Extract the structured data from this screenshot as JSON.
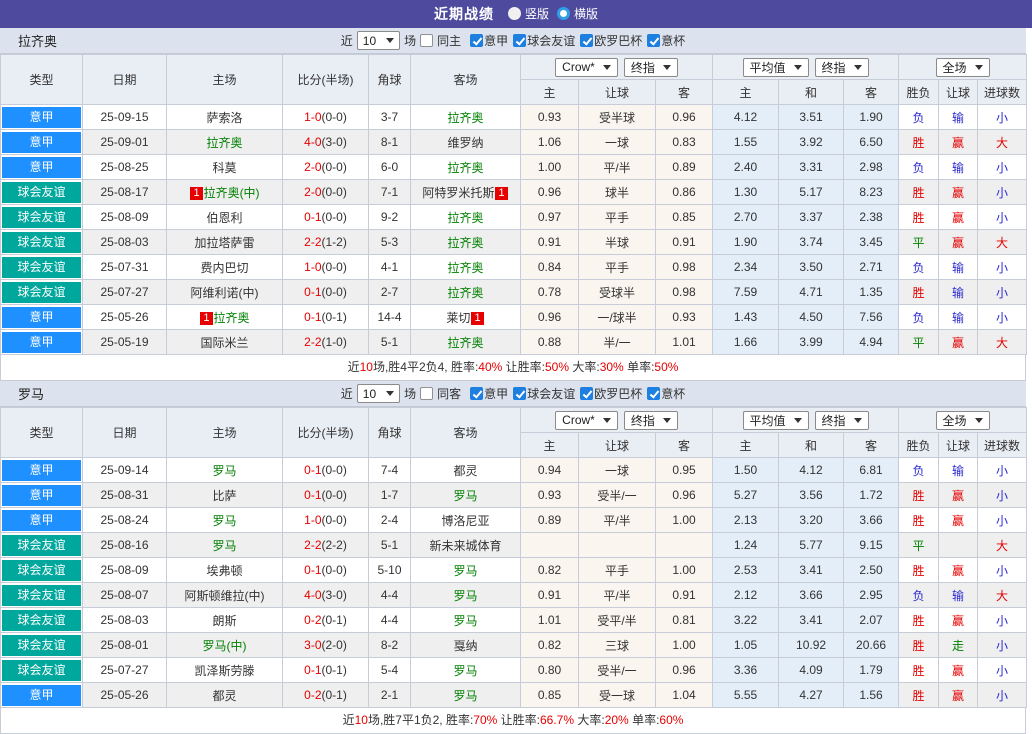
{
  "colors": {
    "title_bar": "#4e4b9e",
    "league_badge": "#1e90ff",
    "friendly_badge": "#00a79c",
    "team_highlight": "#008000",
    "win_red": "#e60000",
    "lose_blue": "#2a2ad0",
    "draw_green": "#008000",
    "odds_col_bg": "#faf5ee",
    "avg_col_bg": "#e3eef8",
    "header_bg": "#e9edf4",
    "section_bg": "#dce3ee",
    "alt_row_bg": "#efefef",
    "checkbox_blue": "#1d7fe0"
  },
  "top_bar": {
    "title": "近期战绩",
    "radios": [
      {
        "label": "竖版",
        "selected": true
      },
      {
        "label": "横版",
        "selected": false
      }
    ]
  },
  "columns": {
    "type": "类型",
    "date": "日期",
    "home": "主场",
    "score": "比分(半场)",
    "corner": "角球",
    "away": "客场",
    "sub": [
      "主",
      "让球",
      "客",
      "主",
      "和",
      "客",
      "胜负",
      "让球",
      "进球数"
    ]
  },
  "controls": {
    "odds_source": "Crow*",
    "final1": "终指",
    "average": "平均值",
    "final2": "终指",
    "scope": "全场"
  },
  "sections": [
    {
      "team": "拉齐奥",
      "filter": {
        "near": "近",
        "count": "10",
        "unit": "场",
        "same": {
          "label": "同主",
          "checked": false
        },
        "leagues": [
          {
            "label": "意甲",
            "checked": true
          },
          {
            "label": "球会友谊",
            "checked": true
          },
          {
            "label": "欧罗巴杯",
            "checked": true
          },
          {
            "label": "意杯",
            "checked": true
          }
        ]
      },
      "rows": [
        {
          "type": "意甲",
          "date": "25-09-15",
          "home": {
            "name": "萨索洛"
          },
          "score": "1-0",
          "half": "0-0",
          "corner": "3-7",
          "away": {
            "name": "拉齐奥",
            "hl": true
          },
          "odds": [
            "0.93",
            "受半球",
            "0.96"
          ],
          "avg": [
            "4.12",
            "3.51",
            "1.90"
          ],
          "res": [
            "负",
            "输",
            "小"
          ]
        },
        {
          "type": "意甲",
          "date": "25-09-01",
          "home": {
            "name": "拉齐奥",
            "hl": true
          },
          "score": "4-0",
          "half": "3-0",
          "corner": "8-1",
          "away": {
            "name": "维罗纳"
          },
          "odds": [
            "1.06",
            "一球",
            "0.83"
          ],
          "avg": [
            "1.55",
            "3.92",
            "6.50"
          ],
          "res": [
            "胜",
            "赢",
            "大"
          ]
        },
        {
          "type": "意甲",
          "date": "25-08-25",
          "home": {
            "name": "科莫"
          },
          "score": "2-0",
          "half": "0-0",
          "corner": "6-0",
          "away": {
            "name": "拉齐奥",
            "hl": true
          },
          "odds": [
            "1.00",
            "平/半",
            "0.89"
          ],
          "avg": [
            "2.40",
            "3.31",
            "2.98"
          ],
          "res": [
            "负",
            "输",
            "小"
          ]
        },
        {
          "type": "球会友谊",
          "date": "25-08-17",
          "home": {
            "name": "拉齐奥(中)",
            "hl": true,
            "badge": "1",
            "badge_pos": "before"
          },
          "score": "2-0",
          "half": "0-0",
          "corner": "7-1",
          "away": {
            "name": "阿特罗米托斯",
            "badge": "1",
            "badge_pos": "after"
          },
          "odds": [
            "0.96",
            "球半",
            "0.86"
          ],
          "avg": [
            "1.30",
            "5.17",
            "8.23"
          ],
          "res": [
            "胜",
            "赢",
            "小"
          ]
        },
        {
          "type": "球会友谊",
          "date": "25-08-09",
          "home": {
            "name": "伯恩利"
          },
          "score": "0-1",
          "half": "0-0",
          "corner": "9-2",
          "away": {
            "name": "拉齐奥",
            "hl": true
          },
          "odds": [
            "0.97",
            "平手",
            "0.85"
          ],
          "avg": [
            "2.70",
            "3.37",
            "2.38"
          ],
          "res": [
            "胜",
            "赢",
            "小"
          ]
        },
        {
          "type": "球会友谊",
          "date": "25-08-03",
          "home": {
            "name": "加拉塔萨雷"
          },
          "score": "2-2",
          "half": "1-2",
          "corner": "5-3",
          "away": {
            "name": "拉齐奥",
            "hl": true
          },
          "odds": [
            "0.91",
            "半球",
            "0.91"
          ],
          "avg": [
            "1.90",
            "3.74",
            "3.45"
          ],
          "res": [
            "平",
            "赢",
            "大"
          ]
        },
        {
          "type": "球会友谊",
          "date": "25-07-31",
          "home": {
            "name": "费内巴切"
          },
          "score": "1-0",
          "half": "0-0",
          "corner": "4-1",
          "away": {
            "name": "拉齐奥",
            "hl": true
          },
          "odds": [
            "0.84",
            "平手",
            "0.98"
          ],
          "avg": [
            "2.34",
            "3.50",
            "2.71"
          ],
          "res": [
            "负",
            "输",
            "小"
          ]
        },
        {
          "type": "球会友谊",
          "date": "25-07-27",
          "home": {
            "name": "阿维利诺(中)"
          },
          "score": "0-1",
          "half": "0-0",
          "corner": "2-7",
          "away": {
            "name": "拉齐奥",
            "hl": true
          },
          "odds": [
            "0.78",
            "受球半",
            "0.98"
          ],
          "avg": [
            "7.59",
            "4.71",
            "1.35"
          ],
          "res": [
            "胜",
            "输",
            "小"
          ]
        },
        {
          "type": "意甲",
          "date": "25-05-26",
          "home": {
            "name": "拉齐奥",
            "hl": true,
            "badge": "1",
            "badge_pos": "before"
          },
          "score": "0-1",
          "half": "0-1",
          "corner": "14-4",
          "away": {
            "name": "莱切",
            "badge": "1",
            "badge_pos": "after"
          },
          "odds": [
            "0.96",
            "一/球半",
            "0.93"
          ],
          "avg": [
            "1.43",
            "4.50",
            "7.56"
          ],
          "res": [
            "负",
            "输",
            "小"
          ]
        },
        {
          "type": "意甲",
          "date": "25-05-19",
          "home": {
            "name": "国际米兰"
          },
          "score": "2-2",
          "half": "1-0",
          "corner": "5-1",
          "away": {
            "name": "拉齐奥",
            "hl": true
          },
          "odds": [
            "0.88",
            "半/一",
            "1.01"
          ],
          "avg": [
            "1.66",
            "3.99",
            "4.94"
          ],
          "res": [
            "平",
            "赢",
            "大"
          ]
        }
      ],
      "summary": [
        {
          "t": "近"
        },
        {
          "t": "10",
          "red": true
        },
        {
          "t": "场,胜4平2负4, 胜率:"
        },
        {
          "t": "40%",
          "red": true
        },
        {
          "t": " 让胜率:"
        },
        {
          "t": "50%",
          "red": true
        },
        {
          "t": " 大率:"
        },
        {
          "t": "30%",
          "red": true
        },
        {
          "t": " 单率:"
        },
        {
          "t": "50%",
          "red": true
        }
      ]
    },
    {
      "team": "罗马",
      "filter": {
        "near": "近",
        "count": "10",
        "unit": "场",
        "same": {
          "label": "同客",
          "checked": false
        },
        "leagues": [
          {
            "label": "意甲",
            "checked": true
          },
          {
            "label": "球会友谊",
            "checked": true
          },
          {
            "label": "欧罗巴杯",
            "checked": true
          },
          {
            "label": "意杯",
            "checked": true
          }
        ]
      },
      "rows": [
        {
          "type": "意甲",
          "date": "25-09-14",
          "home": {
            "name": "罗马",
            "hl": true
          },
          "score": "0-1",
          "half": "0-0",
          "corner": "7-4",
          "away": {
            "name": "都灵"
          },
          "odds": [
            "0.94",
            "一球",
            "0.95"
          ],
          "avg": [
            "1.50",
            "4.12",
            "6.81"
          ],
          "res": [
            "负",
            "输",
            "小"
          ]
        },
        {
          "type": "意甲",
          "date": "25-08-31",
          "home": {
            "name": "比萨"
          },
          "score": "0-1",
          "half": "0-0",
          "corner": "1-7",
          "away": {
            "name": "罗马",
            "hl": true
          },
          "odds": [
            "0.93",
            "受半/一",
            "0.96"
          ],
          "avg": [
            "5.27",
            "3.56",
            "1.72"
          ],
          "res": [
            "胜",
            "赢",
            "小"
          ]
        },
        {
          "type": "意甲",
          "date": "25-08-24",
          "home": {
            "name": "罗马",
            "hl": true
          },
          "score": "1-0",
          "half": "0-0",
          "corner": "2-4",
          "away": {
            "name": "博洛尼亚"
          },
          "odds": [
            "0.89",
            "平/半",
            "1.00"
          ],
          "avg": [
            "2.13",
            "3.20",
            "3.66"
          ],
          "res": [
            "胜",
            "赢",
            "小"
          ]
        },
        {
          "type": "球会友谊",
          "date": "25-08-16",
          "home": {
            "name": "罗马",
            "hl": true
          },
          "score": "2-2",
          "half": "2-2",
          "corner": "5-1",
          "away": {
            "name": "新未来城体育"
          },
          "odds": [
            "",
            "",
            ""
          ],
          "avg": [
            "1.24",
            "5.77",
            "9.15"
          ],
          "res": [
            "平",
            "",
            "大"
          ]
        },
        {
          "type": "球会友谊",
          "date": "25-08-09",
          "home": {
            "name": "埃弗顿"
          },
          "score": "0-1",
          "half": "0-0",
          "corner": "5-10",
          "away": {
            "name": "罗马",
            "hl": true
          },
          "odds": [
            "0.82",
            "平手",
            "1.00"
          ],
          "avg": [
            "2.53",
            "3.41",
            "2.50"
          ],
          "res": [
            "胜",
            "赢",
            "小"
          ]
        },
        {
          "type": "球会友谊",
          "date": "25-08-07",
          "home": {
            "name": "阿斯顿维拉(中)"
          },
          "score": "4-0",
          "half": "3-0",
          "corner": "4-4",
          "away": {
            "name": "罗马",
            "hl": true
          },
          "odds": [
            "0.91",
            "平/半",
            "0.91"
          ],
          "avg": [
            "2.12",
            "3.66",
            "2.95"
          ],
          "res": [
            "负",
            "输",
            "大"
          ]
        },
        {
          "type": "球会友谊",
          "date": "25-08-03",
          "home": {
            "name": "朗斯"
          },
          "score": "0-2",
          "half": "0-1",
          "corner": "4-4",
          "away": {
            "name": "罗马",
            "hl": true
          },
          "odds": [
            "1.01",
            "受平/半",
            "0.81"
          ],
          "avg": [
            "3.22",
            "3.41",
            "2.07"
          ],
          "res": [
            "胜",
            "赢",
            "小"
          ]
        },
        {
          "type": "球会友谊",
          "date": "25-08-01",
          "home": {
            "name": "罗马(中)",
            "hl": true
          },
          "score": "3-0",
          "half": "2-0",
          "corner": "8-2",
          "away": {
            "name": "戛纳"
          },
          "odds": [
            "0.82",
            "三球",
            "1.00"
          ],
          "avg": [
            "1.05",
            "10.92",
            "20.66"
          ],
          "res": [
            "胜",
            "走",
            "小"
          ]
        },
        {
          "type": "球会友谊",
          "date": "25-07-27",
          "home": {
            "name": "凯泽斯劳滕"
          },
          "score": "0-1",
          "half": "0-1",
          "corner": "5-4",
          "away": {
            "name": "罗马",
            "hl": true
          },
          "odds": [
            "0.80",
            "受半/一",
            "0.96"
          ],
          "avg": [
            "3.36",
            "4.09",
            "1.79"
          ],
          "res": [
            "胜",
            "赢",
            "小"
          ]
        },
        {
          "type": "意甲",
          "date": "25-05-26",
          "home": {
            "name": "都灵"
          },
          "score": "0-2",
          "half": "0-1",
          "corner": "2-1",
          "away": {
            "name": "罗马",
            "hl": true
          },
          "odds": [
            "0.85",
            "受一球",
            "1.04"
          ],
          "avg": [
            "5.55",
            "4.27",
            "1.56"
          ],
          "res": [
            "胜",
            "赢",
            "小"
          ]
        }
      ],
      "summary": [
        {
          "t": "近"
        },
        {
          "t": "10",
          "red": true
        },
        {
          "t": "场,胜7平1负2, 胜率:"
        },
        {
          "t": "70%",
          "red": true
        },
        {
          "t": " 让胜率:"
        },
        {
          "t": "66.7%",
          "red": true
        },
        {
          "t": " 大率:"
        },
        {
          "t": "20%",
          "red": true
        },
        {
          "t": " 单率:"
        },
        {
          "t": "60%",
          "red": true
        }
      ]
    }
  ]
}
